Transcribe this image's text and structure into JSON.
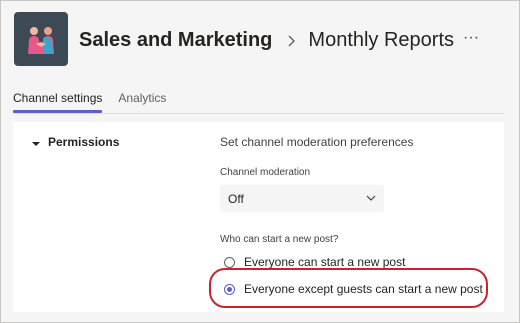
{
  "header": {
    "team_name": "Sales and Marketing",
    "channel_name": "Monthly Reports",
    "more_label": "···"
  },
  "tabs": [
    {
      "label": "Channel settings",
      "active": true
    },
    {
      "label": "Analytics",
      "active": false
    }
  ],
  "permissions": {
    "section_label": "Permissions",
    "description": "Set channel moderation preferences",
    "moderation_label": "Channel moderation",
    "moderation_value": "Off",
    "question": "Who can start a new post?",
    "options": [
      {
        "label": "Everyone can start a new post",
        "selected": false
      },
      {
        "label": "Everyone except guests can start a new post",
        "selected": true
      }
    ]
  },
  "colors": {
    "accent": "#5b5fc7",
    "highlight": "#c4262e",
    "avatar_bg": "#3d4a56"
  }
}
